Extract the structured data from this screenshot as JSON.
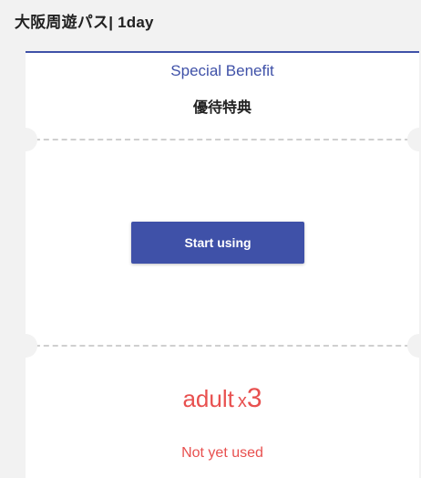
{
  "header": {
    "title": "大阪周遊パス| 1day"
  },
  "ticket": {
    "benefit_label": "Special Benefit",
    "benefit_jp": "優待特典",
    "start_button_label": "Start using",
    "passenger_type": "adult",
    "multiplier": "x",
    "quantity": "3",
    "status": "Not yet used"
  },
  "colors": {
    "accent": "#3f51a8",
    "alert": "#e8504f",
    "background": "#f2f2f2"
  }
}
